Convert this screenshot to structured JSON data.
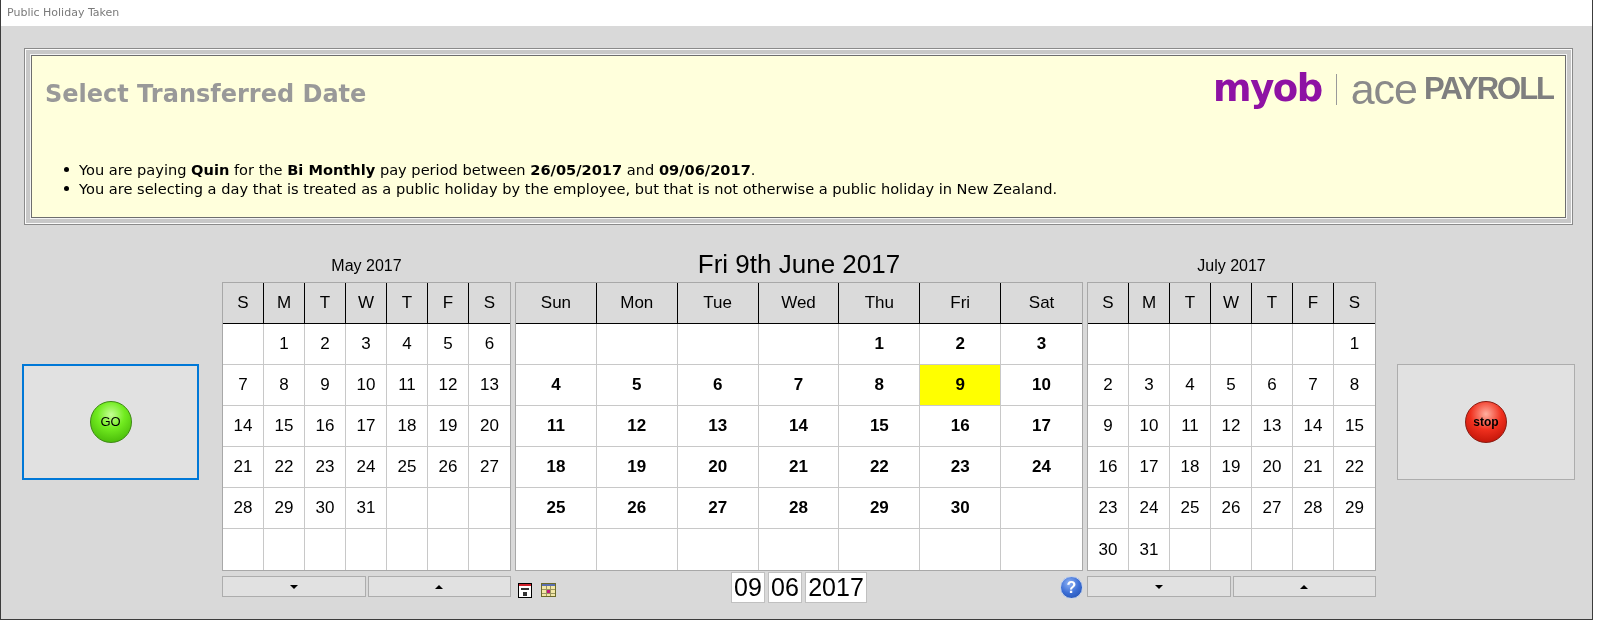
{
  "window": {
    "title": "Public Holiday Taken"
  },
  "header": {
    "title": "Select Transferred Date",
    "logo": {
      "brand": "myob",
      "product": "ace",
      "edition": "PAYROLL"
    },
    "bullets": [
      "You are paying **Quin** for the **Bi Monthly** pay period between **26/05/2017** and **09/06/2017**.",
      "You are selecting a day that is treated as a public holiday by the employee, but that is not otherwise a public holiday in New Zealand."
    ]
  },
  "go_button": {
    "label": "GO",
    "focused": true
  },
  "calendars": [
    {
      "kind": "mini",
      "title": "May 2017",
      "weekdays": [
        "S",
        "M",
        "T",
        "W",
        "T",
        "F",
        "S"
      ],
      "weeks": [
        [
          {
            "kind": "blank"
          },
          {
            "kind": "day",
            "label": "1",
            "selected": false
          },
          {
            "kind": "day",
            "label": "2",
            "selected": false
          },
          {
            "kind": "day",
            "label": "3",
            "selected": false
          },
          {
            "kind": "day",
            "label": "4",
            "selected": false
          },
          {
            "kind": "day",
            "label": "5",
            "selected": false
          },
          {
            "kind": "day",
            "label": "6",
            "selected": false
          }
        ],
        [
          {
            "kind": "day",
            "label": "7",
            "selected": false
          },
          {
            "kind": "day",
            "label": "8",
            "selected": false
          },
          {
            "kind": "day",
            "label": "9",
            "selected": false
          },
          {
            "kind": "day",
            "label": "10",
            "selected": false
          },
          {
            "kind": "day",
            "label": "11",
            "selected": false
          },
          {
            "kind": "day",
            "label": "12",
            "selected": false
          },
          {
            "kind": "day",
            "label": "13",
            "selected": false
          }
        ],
        [
          {
            "kind": "day",
            "label": "14",
            "selected": false
          },
          {
            "kind": "day",
            "label": "15",
            "selected": false
          },
          {
            "kind": "day",
            "label": "16",
            "selected": false
          },
          {
            "kind": "day",
            "label": "17",
            "selected": false
          },
          {
            "kind": "day",
            "label": "18",
            "selected": false
          },
          {
            "kind": "day",
            "label": "19",
            "selected": false
          },
          {
            "kind": "day",
            "label": "20",
            "selected": false
          }
        ],
        [
          {
            "kind": "day",
            "label": "21",
            "selected": false
          },
          {
            "kind": "day",
            "label": "22",
            "selected": false
          },
          {
            "kind": "day",
            "label": "23",
            "selected": false
          },
          {
            "kind": "day",
            "label": "24",
            "selected": false
          },
          {
            "kind": "day",
            "label": "25",
            "selected": false
          },
          {
            "kind": "day",
            "label": "26",
            "selected": false
          },
          {
            "kind": "day",
            "label": "27",
            "selected": false
          }
        ],
        [
          {
            "kind": "day",
            "label": "28",
            "selected": false
          },
          {
            "kind": "day",
            "label": "29",
            "selected": false
          },
          {
            "kind": "day",
            "label": "30",
            "selected": false
          },
          {
            "kind": "day",
            "label": "31",
            "selected": false
          },
          {
            "kind": "blank"
          },
          {
            "kind": "blank"
          },
          {
            "kind": "blank"
          }
        ],
        [
          {
            "kind": "blank"
          },
          {
            "kind": "blank"
          },
          {
            "kind": "blank"
          },
          {
            "kind": "blank"
          },
          {
            "kind": "blank"
          },
          {
            "kind": "blank"
          },
          {
            "kind": "blank"
          }
        ]
      ]
    },
    {
      "kind": "main",
      "title": "Fri 9th June 2017",
      "weekdays": [
        "Sun",
        "Mon",
        "Tue",
        "Wed",
        "Thu",
        "Fri",
        "Sat"
      ],
      "weeks": [
        [
          {
            "kind": "blank"
          },
          {
            "kind": "blank"
          },
          {
            "kind": "blank"
          },
          {
            "kind": "blank"
          },
          {
            "kind": "day",
            "label": "1",
            "selected": false
          },
          {
            "kind": "day",
            "label": "2",
            "selected": false
          },
          {
            "kind": "day",
            "label": "3",
            "selected": false
          }
        ],
        [
          {
            "kind": "day",
            "label": "4",
            "selected": false
          },
          {
            "kind": "day",
            "label": "5",
            "selected": false
          },
          {
            "kind": "day",
            "label": "6",
            "selected": false
          },
          {
            "kind": "day",
            "label": "7",
            "selected": false
          },
          {
            "kind": "day",
            "label": "8",
            "selected": false
          },
          {
            "kind": "day",
            "label": "9",
            "selected": true
          },
          {
            "kind": "day",
            "label": "10",
            "selected": false
          }
        ],
        [
          {
            "kind": "day",
            "label": "11",
            "selected": false
          },
          {
            "kind": "day",
            "label": "12",
            "selected": false
          },
          {
            "kind": "day",
            "label": "13",
            "selected": false
          },
          {
            "kind": "day",
            "label": "14",
            "selected": false
          },
          {
            "kind": "day",
            "label": "15",
            "selected": false
          },
          {
            "kind": "day",
            "label": "16",
            "selected": false
          },
          {
            "kind": "day",
            "label": "17",
            "selected": false
          }
        ],
        [
          {
            "kind": "day",
            "label": "18",
            "selected": false
          },
          {
            "kind": "day",
            "label": "19",
            "selected": false
          },
          {
            "kind": "day",
            "label": "20",
            "selected": false
          },
          {
            "kind": "day",
            "label": "21",
            "selected": false
          },
          {
            "kind": "day",
            "label": "22",
            "selected": false
          },
          {
            "kind": "day",
            "label": "23",
            "selected": false
          },
          {
            "kind": "day",
            "label": "24",
            "selected": false
          }
        ],
        [
          {
            "kind": "day",
            "label": "25",
            "selected": false
          },
          {
            "kind": "day",
            "label": "26",
            "selected": false
          },
          {
            "kind": "day",
            "label": "27",
            "selected": false
          },
          {
            "kind": "day",
            "label": "28",
            "selected": false
          },
          {
            "kind": "day",
            "label": "29",
            "selected": false
          },
          {
            "kind": "day",
            "label": "30",
            "selected": false
          },
          {
            "kind": "blank"
          }
        ],
        [
          {
            "kind": "blank"
          },
          {
            "kind": "blank"
          },
          {
            "kind": "blank"
          },
          {
            "kind": "blank"
          },
          {
            "kind": "blank"
          },
          {
            "kind": "blank"
          },
          {
            "kind": "blank"
          }
        ]
      ],
      "date_fields": [
        "09",
        "06",
        "2017"
      ],
      "help_button": {
        "label": "?"
      }
    },
    {
      "kind": "mini",
      "title": "July 2017",
      "weekdays": [
        "S",
        "M",
        "T",
        "W",
        "T",
        "F",
        "S"
      ],
      "weeks": [
        [
          {
            "kind": "blank"
          },
          {
            "kind": "blank"
          },
          {
            "kind": "blank"
          },
          {
            "kind": "blank"
          },
          {
            "kind": "blank"
          },
          {
            "kind": "blank"
          },
          {
            "kind": "day",
            "label": "1",
            "selected": false
          }
        ],
        [
          {
            "kind": "day",
            "label": "2",
            "selected": false
          },
          {
            "kind": "day",
            "label": "3",
            "selected": false
          },
          {
            "kind": "day",
            "label": "4",
            "selected": false
          },
          {
            "kind": "day",
            "label": "5",
            "selected": false
          },
          {
            "kind": "day",
            "label": "6",
            "selected": false
          },
          {
            "kind": "day",
            "label": "7",
            "selected": false
          },
          {
            "kind": "day",
            "label": "8",
            "selected": false
          }
        ],
        [
          {
            "kind": "day",
            "label": "9",
            "selected": false
          },
          {
            "kind": "day",
            "label": "10",
            "selected": false
          },
          {
            "kind": "day",
            "label": "11",
            "selected": false
          },
          {
            "kind": "day",
            "label": "12",
            "selected": false
          },
          {
            "kind": "day",
            "label": "13",
            "selected": false
          },
          {
            "kind": "day",
            "label": "14",
            "selected": false
          },
          {
            "kind": "day",
            "label": "15",
            "selected": false
          }
        ],
        [
          {
            "kind": "day",
            "label": "16",
            "selected": false
          },
          {
            "kind": "day",
            "label": "17",
            "selected": false
          },
          {
            "kind": "day",
            "label": "18",
            "selected": false
          },
          {
            "kind": "day",
            "label": "19",
            "selected": false
          },
          {
            "kind": "day",
            "label": "20",
            "selected": false
          },
          {
            "kind": "day",
            "label": "21",
            "selected": false
          },
          {
            "kind": "day",
            "label": "22",
            "selected": false
          }
        ],
        [
          {
            "kind": "day",
            "label": "23",
            "selected": false
          },
          {
            "kind": "day",
            "label": "24",
            "selected": false
          },
          {
            "kind": "day",
            "label": "25",
            "selected": false
          },
          {
            "kind": "day",
            "label": "26",
            "selected": false
          },
          {
            "kind": "day",
            "label": "27",
            "selected": false
          },
          {
            "kind": "day",
            "label": "28",
            "selected": false
          },
          {
            "kind": "day",
            "label": "29",
            "selected": false
          }
        ],
        [
          {
            "kind": "day",
            "label": "30",
            "selected": false
          },
          {
            "kind": "day",
            "label": "31",
            "selected": false
          },
          {
            "kind": "blank"
          },
          {
            "kind": "blank"
          },
          {
            "kind": "blank"
          },
          {
            "kind": "blank"
          },
          {
            "kind": "blank"
          }
        ]
      ]
    }
  ],
  "stop_button": {
    "label": "stop",
    "focused": false
  }
}
